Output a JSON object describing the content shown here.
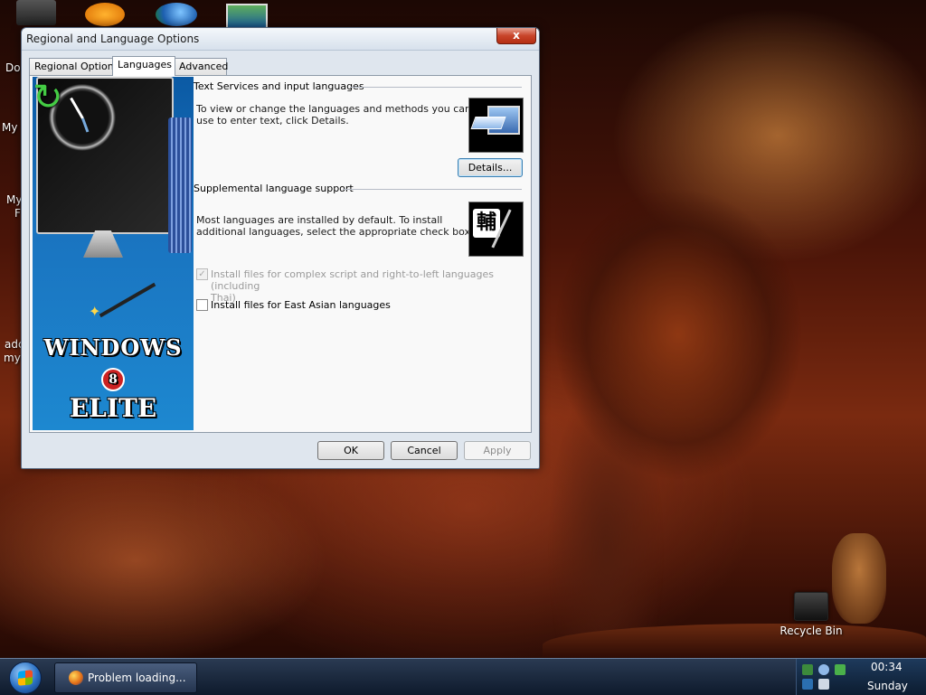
{
  "desktop": {
    "icon_labels": [
      "Do",
      "My C",
      "My",
      "F",
      "adc",
      "my"
    ],
    "recycle_bin_label": "Recycle Bin"
  },
  "dialog": {
    "title": "Regional and Language Options",
    "close_symbol": "x",
    "tabs": [
      {
        "label": "Regional Options",
        "active": false
      },
      {
        "label": "Languages",
        "active": true
      },
      {
        "label": "Advanced",
        "active": false
      }
    ],
    "banner": {
      "line1": "WINDOWS",
      "line2": "8",
      "line3": "ELITE"
    },
    "text_services": {
      "heading": "Text Services and input languages",
      "description_line1": "To view or change the languages and methods you can",
      "description_line2": "use to enter text, click Details.",
      "details_button": "Details..."
    },
    "supplemental": {
      "heading": "Supplemental language support",
      "description_line1": "Most languages are installed by default. To install",
      "description_line2": "additional languages, select the appropriate check box",
      "ime_glyph": "輔",
      "checkbox_complex": {
        "label_line1": "Install files for complex script and right-to-left languages (including",
        "label_line2": "Thai)",
        "checked": true,
        "disabled": true
      },
      "checkbox_east_asian": {
        "label": "Install files for East Asian languages",
        "checked": false,
        "disabled": false
      }
    },
    "buttons": {
      "ok": "OK",
      "cancel": "Cancel",
      "apply": "Apply"
    }
  },
  "taskbar": {
    "task_label": "Problem loading...",
    "clock_time": "00:34",
    "clock_day": "Sunday"
  },
  "colors": {
    "dialog_bg": "#dfe6ee",
    "close_button": "#c8442a",
    "banner_blue": "#1a74c0",
    "taskbar": "#1a2a40"
  }
}
